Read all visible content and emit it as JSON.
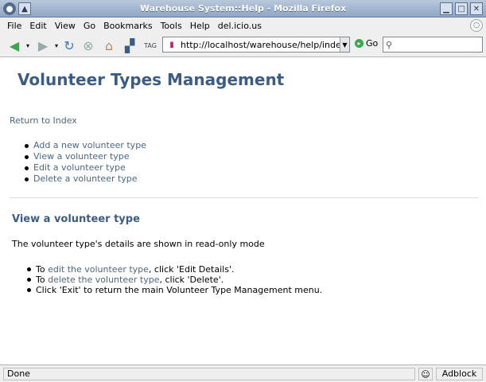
{
  "window": {
    "title": "Warehouse System::Help - Mozilla Firefox"
  },
  "menubar": {
    "items": [
      "File",
      "Edit",
      "View",
      "Go",
      "Bookmarks",
      "Tools",
      "Help",
      "del.icio.us"
    ]
  },
  "navbar": {
    "url": "http://localhost/warehouse/help/index.php",
    "go_label": "Go",
    "search_placeholder": ""
  },
  "page": {
    "title": "Volunteer Types Management",
    "return_link": "Return to Index",
    "menu": [
      "Add a new volunteer type",
      "View a volunteer type",
      "Edit a volunteer type",
      "Delete a volunteer type"
    ],
    "section_title": "View a volunteer type",
    "description": "The volunteer type's details are shown in read-only mode",
    "steps": {
      "s1_prefix": "To ",
      "s1_link": "edit the volunteer type",
      "s1_suffix": ", click 'Edit Details'.",
      "s2_prefix": "To ",
      "s2_link": "delete the volunteer type",
      "s2_suffix": ", click 'Delete'.",
      "s3": "Click 'Exit' to return the main Volunteer Type Management menu."
    }
  },
  "status": {
    "text": "Done",
    "adblock": "Adblock"
  },
  "colors": {
    "heading": "#3b5d85",
    "link": "#4d6680"
  },
  "icons": [
    "back-icon",
    "forward-icon",
    "reload-icon",
    "stop-icon",
    "home-icon",
    "bookmark-tag-icon",
    "go-icon",
    "search-icon"
  ]
}
